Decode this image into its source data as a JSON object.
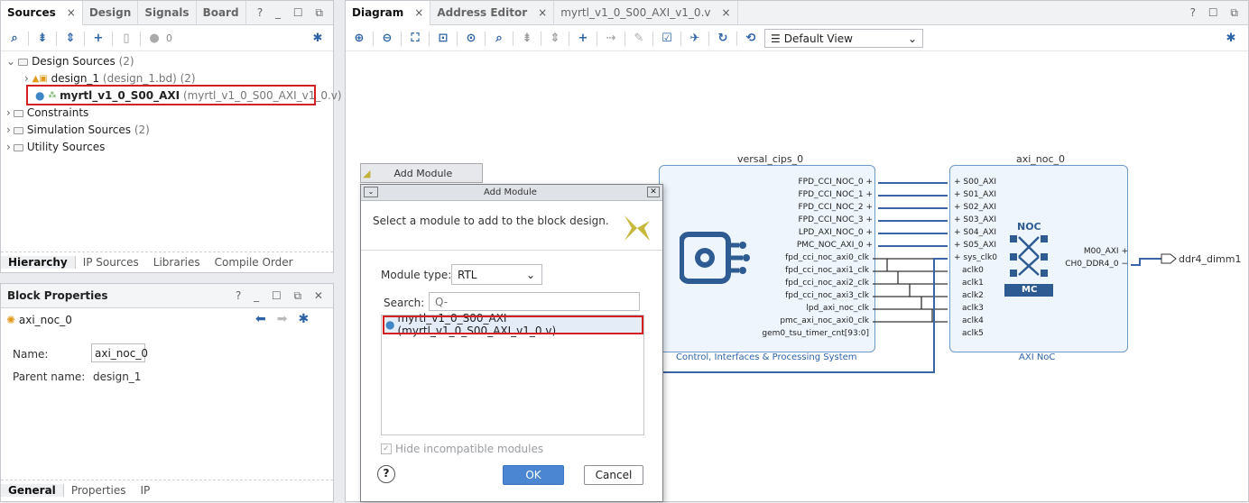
{
  "sources": {
    "tabs": [
      "Sources",
      "Design",
      "Signals",
      "Board"
    ],
    "toolbar_count": "0",
    "tree": {
      "design_sources": "Design Sources",
      "design_sources_count": "(2)",
      "design_1": "design_1",
      "design_1_file": "(design_1.bd)",
      "design_1_count": "(2)",
      "myrtl": "myrtl_v1_0_S00_AXI",
      "myrtl_file": "(myrtl_v1_0_S00_AXI_v1_0.v)",
      "constraints": "Constraints",
      "sim": "Simulation Sources",
      "sim_count": "(2)",
      "util": "Utility Sources"
    },
    "bottom_tabs": [
      "Hierarchy",
      "IP Sources",
      "Libraries",
      "Compile Order"
    ]
  },
  "block_props": {
    "title": "Block Properties",
    "item": "axi_noc_0",
    "name_label": "Name:",
    "name_value": "axi_noc_0",
    "parent_label": "Parent name:",
    "parent_value": "design_1",
    "bottom_tabs": [
      "General",
      "Properties",
      "IP"
    ]
  },
  "diagram": {
    "tabs": [
      "Diagram",
      "Address Editor",
      "myrtl_v1_0_S00_AXI_v1_0.v"
    ],
    "view": "Default View",
    "cips": {
      "name": "versal_cips_0",
      "subtitle": "Control, Interfaces & Processing System",
      "ports": [
        "FPD_CCI_NOC_0",
        "FPD_CCI_NOC_1",
        "FPD_CCI_NOC_2",
        "FPD_CCI_NOC_3",
        "LPD_AXI_NOC_0",
        "PMC_NOC_AXI_0",
        "fpd_cci_noc_axi0_clk",
        "fpd_cci_noc_axi1_clk",
        "fpd_cci_noc_axi2_clk",
        "fpd_cci_noc_axi3_clk",
        "lpd_axi_noc_clk",
        "pmc_axi_noc_axi0_clk",
        "gem0_tsu_timer_cnt[93:0]"
      ]
    },
    "noc": {
      "name": "axi_noc_0",
      "subtitle": "AXI NoC",
      "in_ports": [
        "S00_AXI",
        "S01_AXI",
        "S02_AXI",
        "S03_AXI",
        "S04_AXI",
        "S05_AXI",
        "sys_clk0",
        "aclk0",
        "aclk1",
        "aclk2",
        "aclk3",
        "aclk4",
        "aclk5"
      ],
      "out_ports": [
        "M00_AXI",
        "CH0_DDR4_0"
      ],
      "logo_top": "NOC",
      "logo_bottom": "MC"
    },
    "ext_port": "ddr4_dimm1"
  },
  "add_module_tooltip": "Add Module",
  "dialog": {
    "title": "Add Module",
    "description": "Select a module to add to the block design.",
    "module_type_label": "Module type:",
    "module_type_value": "RTL",
    "search_label": "Search:",
    "search_placeholder": "Q-",
    "list": [
      "myrtl_v1_0_S00_AXI (myrtl_v1_0_S00_AXI_v1_0.v)"
    ],
    "hide_label": "Hide incompatible modules",
    "ok": "OK",
    "cancel": "Cancel",
    "help": "?"
  }
}
